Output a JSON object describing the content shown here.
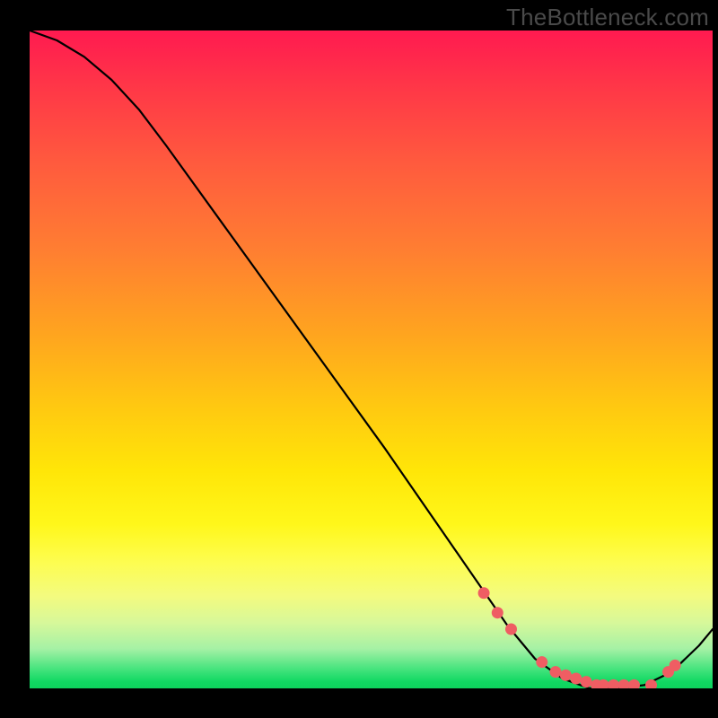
{
  "watermark": "TheBottleneck.com",
  "chart_data": {
    "type": "line",
    "title": "",
    "xlabel": "",
    "ylabel": "",
    "x_range": [
      0,
      100
    ],
    "y_range": [
      0,
      100
    ],
    "series": [
      {
        "name": "curve",
        "x": [
          0,
          4,
          8,
          12,
          16,
          20,
          28,
          36,
          44,
          52,
          60,
          66,
          70,
          74,
          78,
          82,
          86,
          90,
          94,
          98,
          100
        ],
        "y": [
          100,
          98.5,
          96,
          92.5,
          88,
          82.5,
          71,
          59.5,
          48,
          36.5,
          24.5,
          15.5,
          9.5,
          4.5,
          1.5,
          0,
          0,
          0.5,
          2.5,
          6.5,
          9
        ]
      }
    ],
    "markers": {
      "name": "dots",
      "x": [
        66.5,
        68.5,
        70.5,
        75,
        77,
        78.5,
        80,
        81.5,
        83,
        84,
        85.5,
        87,
        88.5,
        91,
        93.5,
        94.5
      ],
      "y": [
        14.5,
        11.5,
        9,
        4,
        2.5,
        2,
        1.5,
        1,
        0.5,
        0.5,
        0.5,
        0.5,
        0.5,
        0.5,
        2.5,
        3.5
      ]
    },
    "gradient_stops": [
      {
        "pos": 0.0,
        "color": "#ff1a50"
      },
      {
        "pos": 0.2,
        "color": "#ff5a3e"
      },
      {
        "pos": 0.46,
        "color": "#ffa41f"
      },
      {
        "pos": 0.75,
        "color": "#fff71a"
      },
      {
        "pos": 0.94,
        "color": "#a5f1a5"
      },
      {
        "pos": 1.0,
        "color": "#0ed35d"
      }
    ]
  }
}
